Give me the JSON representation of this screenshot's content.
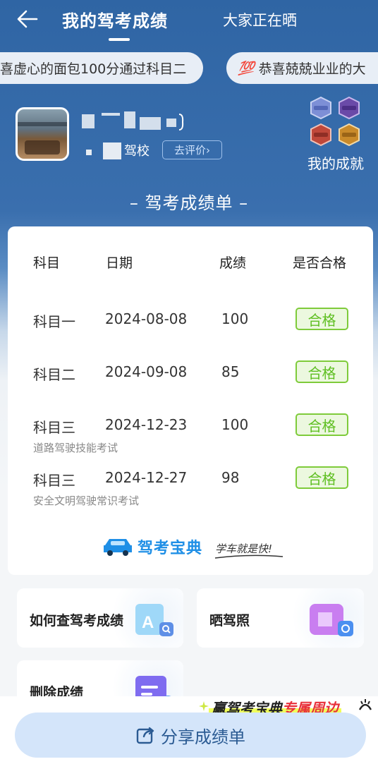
{
  "header": {
    "tabs": [
      {
        "label": "我的驾考成绩",
        "active": true
      },
      {
        "label": "大家正在晒",
        "active": false
      }
    ]
  },
  "marquee": [
    {
      "text": "喜虚心的面包100分通过科目二",
      "icon": ""
    },
    {
      "text": "恭喜兢兢业业的大",
      "icon": "💯"
    }
  ],
  "profile": {
    "school_suffix": "驾校",
    "review_label": "去评价",
    "achievements_label": "我的成就"
  },
  "section_title": "– 驾考成绩单 –",
  "table": {
    "headers": [
      "科目",
      "日期",
      "成绩",
      "是否合格"
    ],
    "rows": [
      {
        "subject": "科目一",
        "date": "2024-08-08",
        "score": "100",
        "status": "合格",
        "note": ""
      },
      {
        "subject": "科目二",
        "date": "2024-09-08",
        "score": "85",
        "status": "合格",
        "note": ""
      },
      {
        "subject": "科目三",
        "date": "2024-12-23",
        "score": "100",
        "status": "合格",
        "note": "道路驾驶技能考试"
      },
      {
        "subject": "科目三",
        "date": "2024-12-27",
        "score": "98",
        "status": "合格",
        "note": "安全文明驾驶常识考试"
      }
    ]
  },
  "brand": {
    "logo_text": "驾考宝典",
    "slogan": "学车就是快!"
  },
  "actions": {
    "query_label": "如何查驾考成绩",
    "license_label": "晒驾照",
    "delete_label": "删除成绩"
  },
  "promo": {
    "part1": "赢驾考宝典",
    "part2": "专属周边"
  },
  "share_label": "分享成绩单",
  "colors": {
    "header_blue": "#2f65a4",
    "pass_green": "#5fbf22",
    "brand_blue": "#1f8fe6",
    "share_bg": "#d4e5fa"
  }
}
